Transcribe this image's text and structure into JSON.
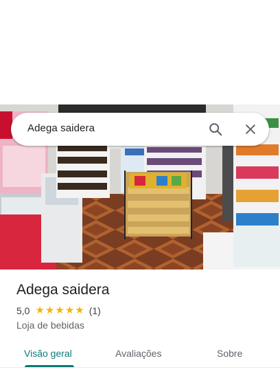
{
  "search": {
    "query": "Adega saidera"
  },
  "icons": {
    "search": "search-icon",
    "close": "close-icon",
    "star": "star-icon"
  },
  "place": {
    "name": "Adega saidera",
    "rating_value": "5,0",
    "stars": 5,
    "review_count": "(1)",
    "category": "Loja de bebidas"
  },
  "tabs": [
    {
      "label": "Visão geral",
      "selected": true
    },
    {
      "label": "Avaliações",
      "selected": false
    },
    {
      "label": "Sobre",
      "selected": false
    }
  ],
  "colors": {
    "accent": "#0b7a76",
    "star": "#f4b400",
    "text_primary": "#202124",
    "text_secondary": "#5f6368"
  }
}
